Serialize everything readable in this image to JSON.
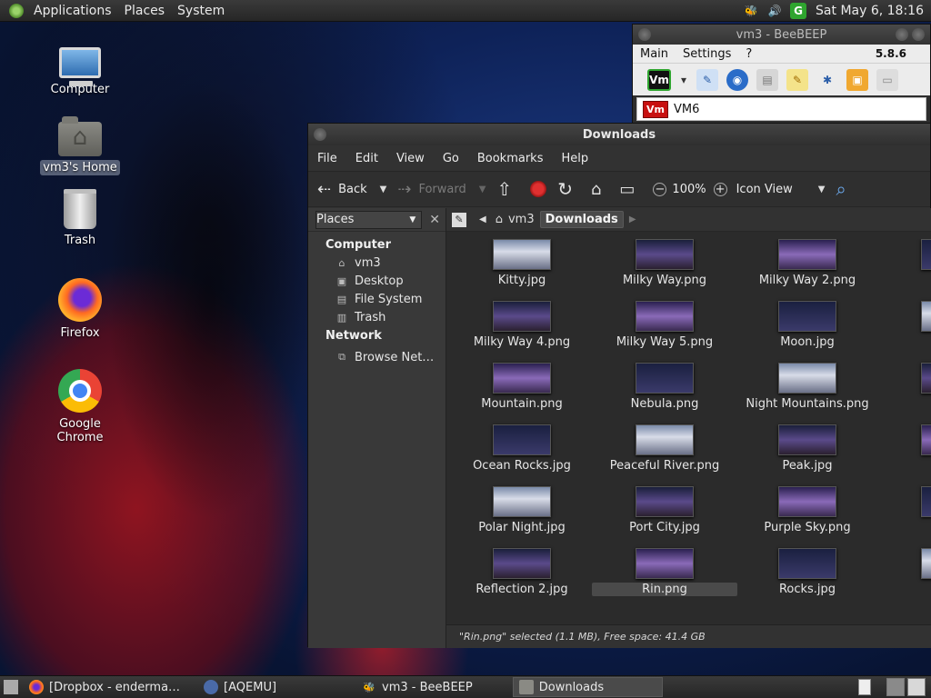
{
  "top_panel": {
    "menus": [
      "Applications",
      "Places",
      "System"
    ],
    "clock": "Sat May  6, 18:16"
  },
  "desktop": {
    "icons": [
      {
        "label": "Computer"
      },
      {
        "label": "vm3's Home"
      },
      {
        "label": "Trash"
      },
      {
        "label": "Firefox"
      },
      {
        "label": "Google Chrome"
      }
    ]
  },
  "beebeep": {
    "title": "vm3 - BeeBEEP",
    "menu": [
      "Main",
      "Settings",
      "?"
    ],
    "version": "5.8.6",
    "vm_badge": "Vm",
    "users": [
      {
        "badge": "Vm",
        "name": "VM6"
      }
    ]
  },
  "downloads": {
    "title": "Downloads",
    "menu": [
      "File",
      "Edit",
      "View",
      "Go",
      "Bookmarks",
      "Help"
    ],
    "toolbar": {
      "back": "Back",
      "forward": "Forward",
      "zoom": "100%",
      "view_mode": "Icon View"
    },
    "sidebar": {
      "selector": "Places",
      "computer_heading": "Computer",
      "computer_items": [
        "vm3",
        "Desktop",
        "File System",
        "Trash"
      ],
      "network_heading": "Network",
      "network_items": [
        "Browse Net…"
      ]
    },
    "path": [
      "vm3",
      "Downloads"
    ],
    "files": [
      [
        "Kitty.jpg",
        "Milky Way.png",
        "Milky Way 2.png",
        "Milky"
      ],
      [
        "Milky Way 4.png",
        "Milky Way 5.png",
        "Moon.jpg",
        "Mo"
      ],
      [
        "Mountain.png",
        "Nebula.png",
        "Night Mountains.png",
        "Northe"
      ],
      [
        "Ocean Rocks.jpg",
        "Peaceful River.png",
        "Peak.jpg",
        "P"
      ],
      [
        "Polar Night.jpg",
        "Port City.jpg",
        "Purple Sky.png",
        "Re"
      ],
      [
        "Reflection 2.jpg",
        "Rin.png",
        "Rocks.jpg",
        "Sa"
      ]
    ],
    "selected_file": "Rin.png",
    "status": "\"Rin.png\" selected (1.1 MB), Free space: 41.4 GB"
  },
  "taskbar": {
    "tasks": [
      "[Dropbox - enderma…",
      "[AQEMU]",
      "vm3 - BeeBEEP",
      "Downloads"
    ],
    "active_task": "Downloads"
  },
  "colors": {
    "panel": "#2f2f2f",
    "window_bg": "#323232",
    "stop": "#e03030",
    "vm_badge": "#c81010"
  }
}
